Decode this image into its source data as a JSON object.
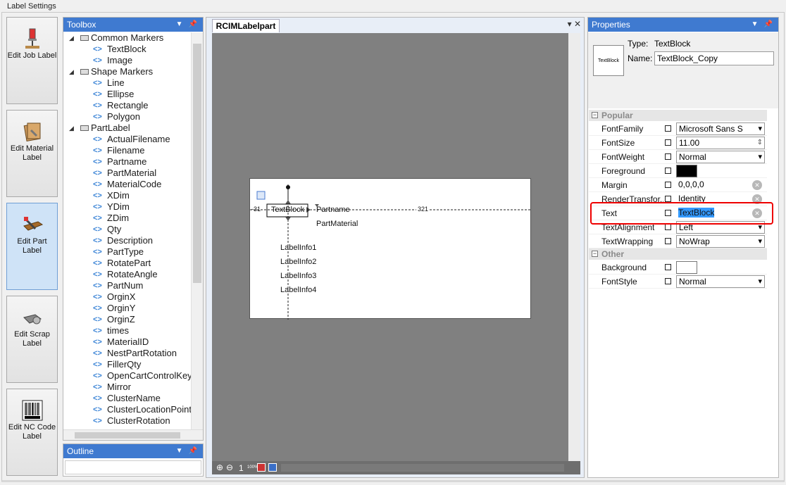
{
  "window": {
    "title": "Label Settings"
  },
  "side_buttons": [
    {
      "label": "Edit Job Label",
      "icon": "job-label-icon",
      "active": false
    },
    {
      "label": "Edit Material Label",
      "icon": "material-label-icon",
      "active": false
    },
    {
      "label": "Edit Part Label",
      "icon": "part-label-icon",
      "active": true
    },
    {
      "label": "Edit Scrap Label",
      "icon": "scrap-label-icon",
      "active": false
    },
    {
      "label": "Edit NC Code Label",
      "icon": "barcode-icon",
      "active": false
    }
  ],
  "toolbox": {
    "title": "Toolbox",
    "groups": [
      {
        "name": "Common Markers",
        "items": [
          "TextBlock",
          "Image"
        ]
      },
      {
        "name": "Shape Markers",
        "items": [
          "Line",
          "Ellipse",
          "Rectangle",
          "Polygon"
        ]
      },
      {
        "name": "PartLabel",
        "items": [
          "ActualFilename",
          "Filename",
          "Partname",
          "PartMaterial",
          "MaterialCode",
          "XDim",
          "YDim",
          "ZDim",
          "Qty",
          "Description",
          "PartType",
          "RotatePart",
          "RotateAngle",
          "PartNum",
          "OrginX",
          "OrginY",
          "OrginZ",
          "times",
          "MaterialID",
          "NestPartRotation",
          "FillerQty",
          "OpenCartControlKey",
          "Mirror",
          "ClusterName",
          "ClusterLocationPoint",
          "ClusterRotation"
        ]
      }
    ]
  },
  "outline": {
    "title": "Outline"
  },
  "document": {
    "tab_label": "RCIMLabelpart",
    "zoom": "1",
    "zoom_pct": "100%",
    "label_texts": {
      "textblock": "TextBlock",
      "partname": "Partname",
      "partmaterial": "PartMaterial",
      "info1": "LabelInfo1",
      "info2": "LabelInfo2",
      "info3": "LabelInfo3",
      "info4": "LabelInfo4",
      "ruler_left": "-31",
      "ruler_right": "321"
    }
  },
  "properties": {
    "title": "Properties",
    "type_label": "Type:",
    "type_value": "TextBlock",
    "name_label": "Name:",
    "name_value": "TextBlock_Copy",
    "thumb_text": "TextBlock",
    "categories": [
      {
        "name": "Popular",
        "rows": [
          {
            "name": "FontFamily",
            "value": "Microsoft Sans S",
            "kind": "combo"
          },
          {
            "name": "FontSize",
            "value": "11.00",
            "kind": "spin"
          },
          {
            "name": "FontWeight",
            "value": "Normal",
            "kind": "combo"
          },
          {
            "name": "Foreground",
            "value": "",
            "kind": "color",
            "color": "#000000"
          },
          {
            "name": "Margin",
            "value": "0,0,0,0",
            "kind": "clear"
          },
          {
            "name": "RenderTransfor...",
            "value": "Identity",
            "kind": "clear"
          },
          {
            "name": "Text",
            "value": "TextBlock",
            "kind": "clear-selected"
          },
          {
            "name": "TextAlignment",
            "value": "Left",
            "kind": "combo"
          },
          {
            "name": "TextWrapping",
            "value": "NoWrap",
            "kind": "combo"
          }
        ]
      },
      {
        "name": "Other",
        "rows": [
          {
            "name": "Background",
            "value": "",
            "kind": "color",
            "color": "#ffffff"
          },
          {
            "name": "FontStyle",
            "value": "Normal",
            "kind": "combo"
          }
        ]
      }
    ]
  },
  "colors": {
    "accent": "#3f7ad0",
    "highlight": "#e00000",
    "canvas": "#808080"
  }
}
